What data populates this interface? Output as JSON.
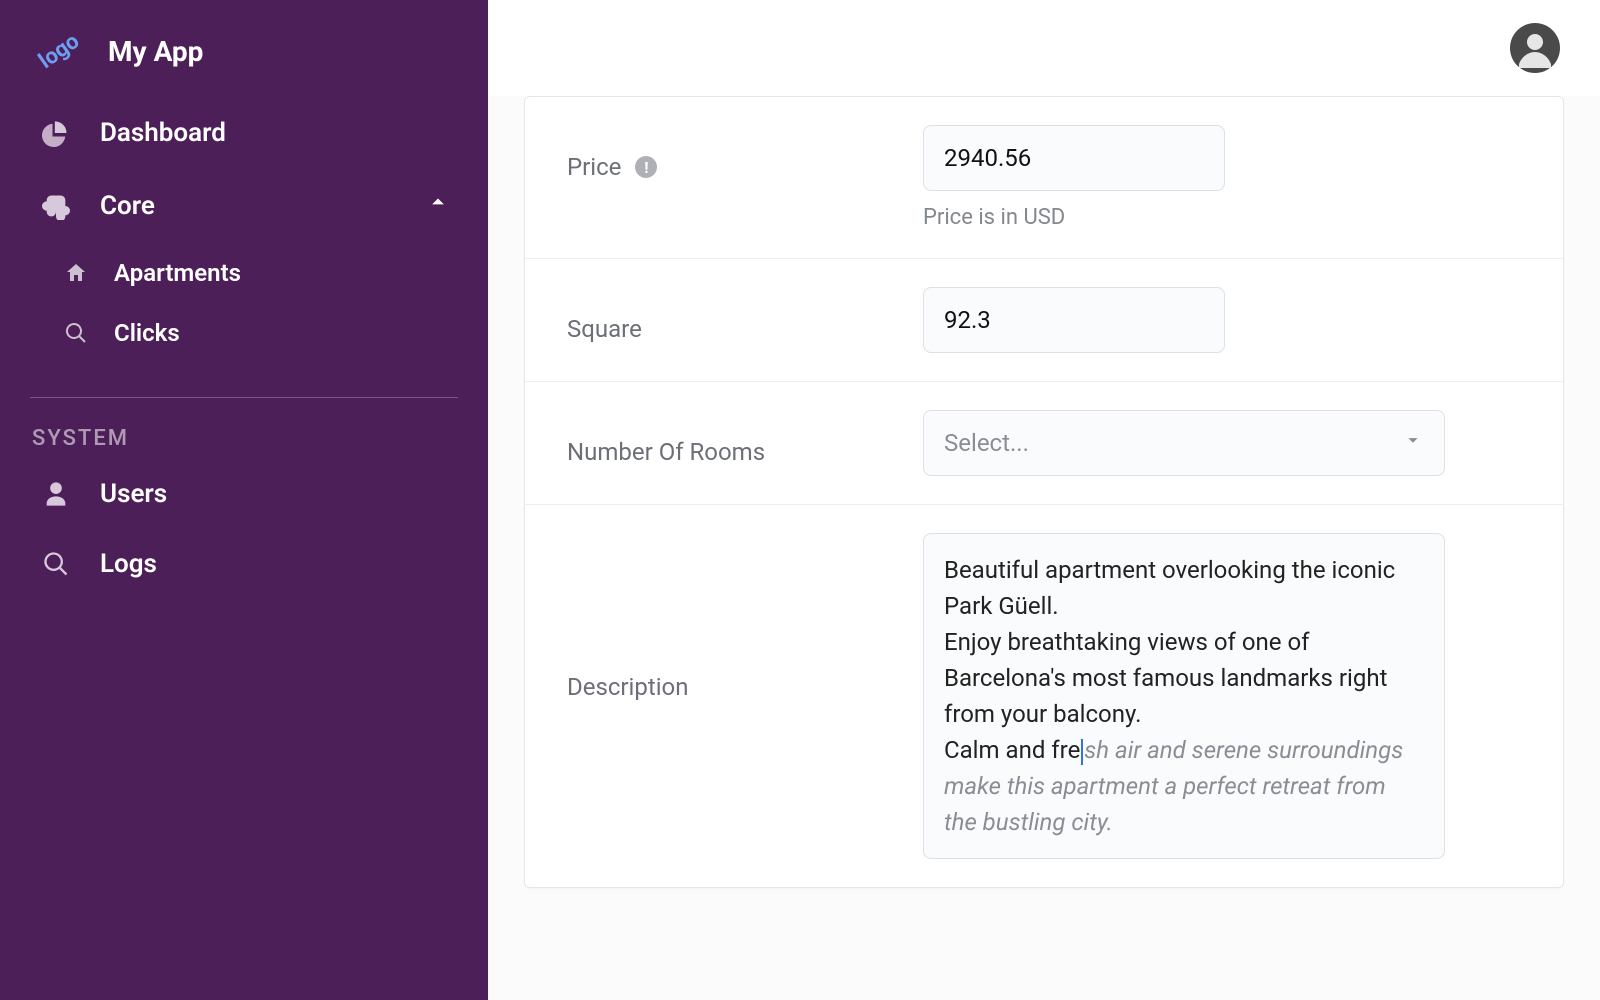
{
  "brand": {
    "logo_text": "logo",
    "title": "My App"
  },
  "sidebar": {
    "items": [
      {
        "label": "Dashboard"
      },
      {
        "label": "Core"
      }
    ],
    "core_children": [
      {
        "label": "Apartments"
      },
      {
        "label": "Clicks"
      }
    ],
    "system_header": "SYSTEM",
    "system_items": [
      {
        "label": "Users"
      },
      {
        "label": "Logs"
      }
    ]
  },
  "form": {
    "price": {
      "label": "Price",
      "value": "2940.56",
      "help": "Price is in USD"
    },
    "square": {
      "label": "Square",
      "value": "92.3"
    },
    "rooms": {
      "label": "Number Of Rooms",
      "placeholder": "Select..."
    },
    "description": {
      "label": "Description",
      "typed": "Beautiful apartment overlooking the iconic Park Güell.\nEnjoy breathtaking views of one of Barcelona's most famous landmarks right from your balcony.\nCalm and fre",
      "suggestion": "sh air and serene surroundings make this apartment a perfect retreat from the bustling city."
    }
  }
}
